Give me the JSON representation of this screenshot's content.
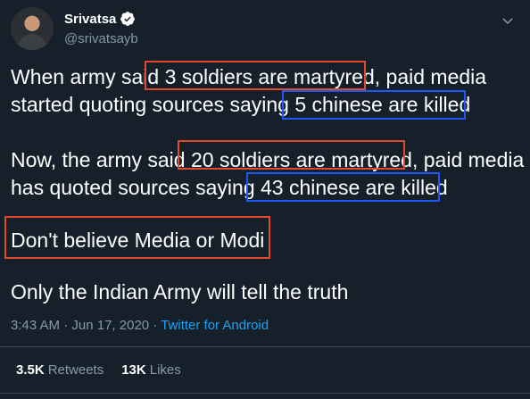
{
  "author": {
    "display_name": "Srivatsa",
    "handle": "@srivatsayb"
  },
  "tweet": {
    "p1_l1_a": "When army said ",
    "p1_l1_b": "3 soldiers are martyred",
    "p1_l1_c": ", paid media",
    "p1_l2_a": "started quoting sources saying ",
    "p1_l2_b": "5 chinese are killed",
    "p2_l1_a": "Now, the army said ",
    "p2_l1_b": "20 soldiers are martyred",
    "p2_l1_c": ", paid media",
    "p2_l2_a": "has quoted sources saying ",
    "p2_l2_b": "43 chinese are killed",
    "p3": "Don't believe Media or Modi",
    "p4": "Only the Indian Army will tell the truth"
  },
  "meta": {
    "time": "3:43 AM",
    "sep1": " · ",
    "date": "Jun 17, 2020",
    "sep2": " · ",
    "source": "Twitter for Android"
  },
  "stats": {
    "retweets_count": "3.5K",
    "retweets_label": "Retweets",
    "likes_count": "13K",
    "likes_label": "Likes"
  },
  "icons": {
    "verified": "verified-badge-icon",
    "caret": "chevron-down-icon"
  },
  "colors": {
    "background": "#15202b",
    "highlight_red": "#e04a2f",
    "highlight_blue": "#1f57ff",
    "link_blue": "#1da1f2",
    "muted": "#8899a6"
  }
}
